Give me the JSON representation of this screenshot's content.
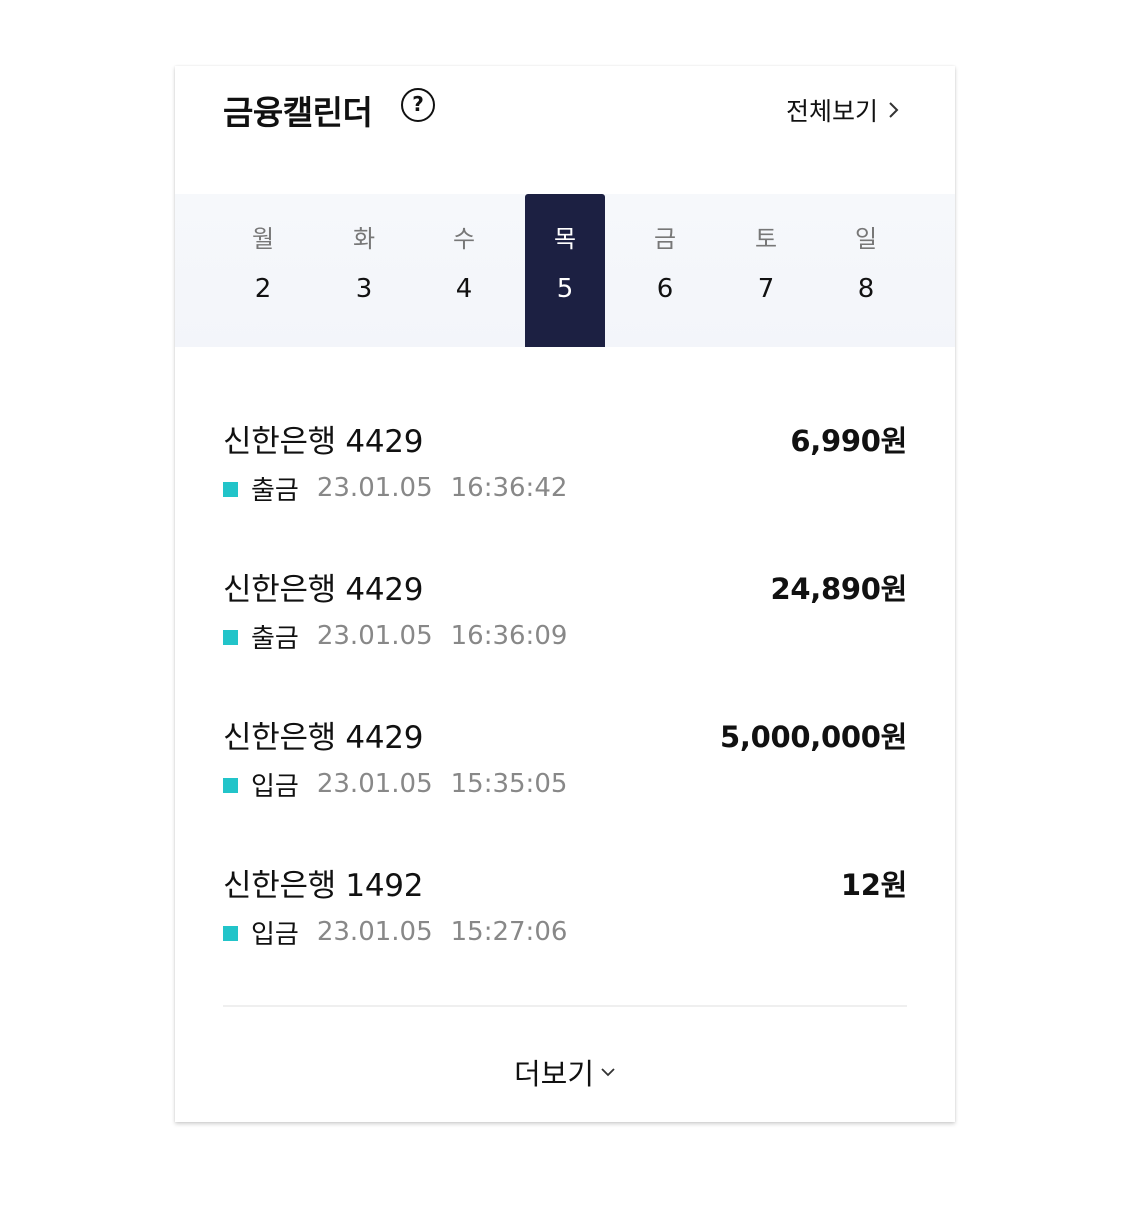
{
  "header": {
    "title": "금융캘린더",
    "help_icon": "?",
    "view_all_label": "전체보기"
  },
  "week": {
    "selected_index": 3,
    "selected_color": "#1c2042",
    "days": [
      {
        "dow": "월",
        "num": "2"
      },
      {
        "dow": "화",
        "num": "3"
      },
      {
        "dow": "수",
        "num": "4"
      },
      {
        "dow": "목",
        "num": "5"
      },
      {
        "dow": "금",
        "num": "6"
      },
      {
        "dow": "토",
        "num": "7"
      },
      {
        "dow": "일",
        "num": "8"
      }
    ]
  },
  "transactions": [
    {
      "account": "신한은행 4429",
      "type": "출금",
      "date": "23.01.05",
      "time": "16:36:42",
      "amount": "6,990원"
    },
    {
      "account": "신한은행 4429",
      "type": "출금",
      "date": "23.01.05",
      "time": "16:36:09",
      "amount": "24,890원"
    },
    {
      "account": "신한은행 4429",
      "type": "입금",
      "date": "23.01.05",
      "time": "15:35:05",
      "amount": "5,000,000원"
    },
    {
      "account": "신한은행 1492",
      "type": "입금",
      "date": "23.01.05",
      "time": "15:27:06",
      "amount": "12원"
    }
  ],
  "marker_color": "#22c4c9",
  "footer": {
    "more_label": "더보기",
    "more_icon": "chevron-down-icon"
  }
}
